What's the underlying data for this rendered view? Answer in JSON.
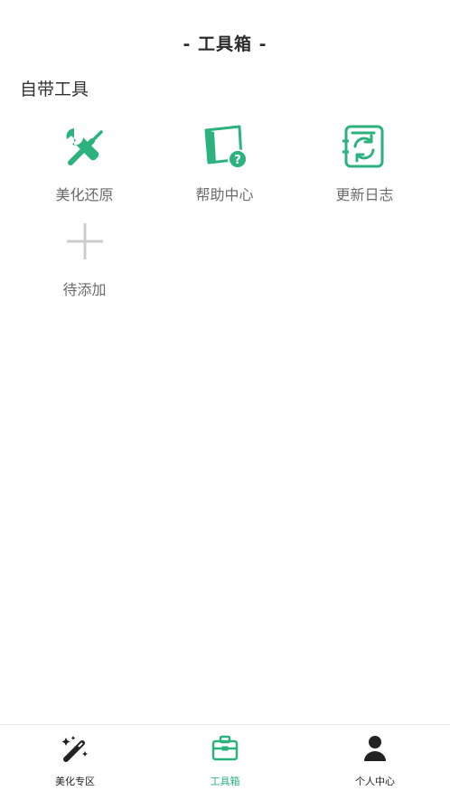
{
  "header": {
    "title": "- 工具箱 -"
  },
  "section": {
    "title": "自带工具"
  },
  "tools": [
    {
      "label": "美化还原",
      "icon": "wrench-screwdriver-icon"
    },
    {
      "label": "帮助中心",
      "icon": "help-book-icon"
    },
    {
      "label": "更新日志",
      "icon": "refresh-log-icon"
    },
    {
      "label": "待添加",
      "icon": "plus-icon"
    }
  ],
  "tabbar": {
    "items": [
      {
        "label": "美化专区",
        "icon": "magic-wand-icon",
        "active": false
      },
      {
        "label": "工具箱",
        "icon": "toolbox-icon",
        "active": true
      },
      {
        "label": "个人中心",
        "icon": "user-icon",
        "active": false
      }
    ]
  },
  "colors": {
    "accent": "#2bb27f",
    "text": "#333333",
    "muted": "#6b6b6b",
    "plus": "#cccccc"
  }
}
